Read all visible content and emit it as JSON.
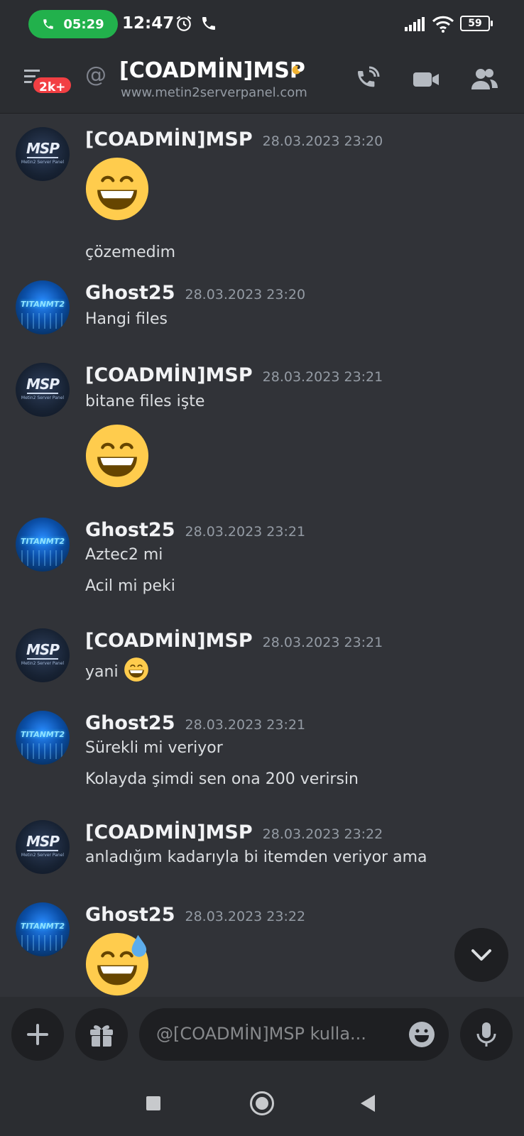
{
  "status_bar": {
    "call_duration": "05:29",
    "time": "12:47",
    "battery": "59",
    "icons": [
      "phone-icon",
      "alarm-icon",
      "call-icon",
      "signal-icon",
      "wifi-icon",
      "battery-icon"
    ]
  },
  "header": {
    "unread_badge": "2k+",
    "at_symbol": "@",
    "title": "[COADMİN]MSP",
    "subtitle": "www.metin2serverpanel.com",
    "icons": [
      "menu-icon",
      "moon-icon",
      "voice-call-icon",
      "video-call-icon",
      "members-icon"
    ]
  },
  "messages": [
    {
      "author": "[COADMİN]MSP",
      "timestamp": "28.03.2023 23:20",
      "avatar_text": "MSP",
      "avatar_sub": "Metin2 Server Panel",
      "lines": [
        "çözemedim"
      ],
      "emoji": "grinning-face"
    },
    {
      "author": "Ghost25",
      "timestamp": "28.03.2023 23:20",
      "avatar_text": "TITANMT2",
      "lines": [
        "Hangi files"
      ]
    },
    {
      "author": "[COADMİN]MSP",
      "timestamp": "28.03.2023 23:21",
      "avatar_text": "MSP",
      "avatar_sub": "Metin2 Server Panel",
      "lines": [
        "bitane files işte"
      ],
      "emoji": "grinning-face"
    },
    {
      "author": "Ghost25",
      "timestamp": "28.03.2023 23:21",
      "avatar_text": "TITANMT2",
      "lines": [
        "Aztec2 mi",
        "Acil mi peki"
      ]
    },
    {
      "author": "[COADMİN]MSP",
      "timestamp": "28.03.2023 23:21",
      "avatar_text": "MSP",
      "avatar_sub": "Metin2 Server Panel",
      "lines": [
        "yani"
      ],
      "emoji": "grinning-face"
    },
    {
      "author": "Ghost25",
      "timestamp": "28.03.2023 23:21",
      "avatar_text": "TITANMT2",
      "lines": [
        "Sürekli mi veriyor",
        "Kolayda şimdi sen ona 200 verirsin"
      ]
    },
    {
      "author": "[COADMİN]MSP",
      "timestamp": "28.03.2023 23:22",
      "avatar_text": "MSP",
      "avatar_sub": "Metin2 Server Panel",
      "lines": [
        "anladığım kadarıyla bi itemden veriyor ama"
      ]
    },
    {
      "author": "Ghost25",
      "timestamp": "28.03.2023 23:22",
      "avatar_text": "TITANMT2",
      "emoji": "grinning-face-with-sweat"
    }
  ],
  "composer": {
    "placeholder": "@[COADMİN]MSP kulla...",
    "icons": [
      "plus-icon",
      "gift-icon",
      "emoji-icon",
      "microphone-icon",
      "chevron-down-icon"
    ]
  },
  "navigation": {
    "icons": [
      "recents-icon",
      "home-icon",
      "back-icon"
    ]
  },
  "colors": {
    "background": "#313338",
    "header": "#2b2d31",
    "call_pill": "#22b14c",
    "badge": "#f23f43",
    "timestamp": "#949ba4"
  }
}
